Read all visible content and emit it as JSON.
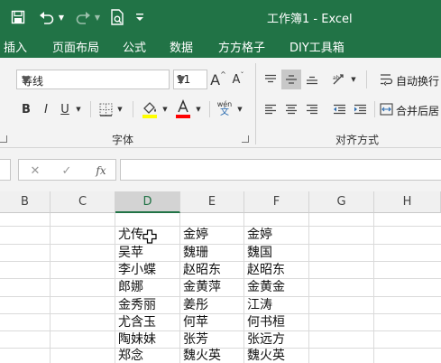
{
  "titlebar": {
    "title": "工作簿1  -  Excel",
    "icons": [
      "save-icon",
      "undo-icon",
      "redo-icon",
      "print-preview-icon",
      "customize-qat-icon"
    ]
  },
  "menu": {
    "tabs": [
      "插入",
      "页面布局",
      "公式",
      "数据",
      "方方格子",
      "DIY工具箱"
    ]
  },
  "ribbon": {
    "font_name": "等线",
    "font_size": "11",
    "grow_font": "A",
    "shrink_font": "A",
    "bold": "B",
    "italic": "I",
    "underline": "U",
    "pinyin_top": "wén",
    "pinyin_bottom": "文",
    "font_group_label": "字体",
    "align_group_label": "对齐方式",
    "wrap_text": "自动换行",
    "merge_center": "合并后居",
    "fill_color": "#ffff00",
    "font_color": "#ff0000"
  },
  "formula_bar": {
    "cancel": "✕",
    "confirm": "✓",
    "fx": "fx",
    "value": ""
  },
  "grid": {
    "columns": [
      "B",
      "C",
      "D",
      "E",
      "F",
      "G",
      "H"
    ],
    "active_column": "D",
    "rows": [
      [
        "尤传",
        "金婷",
        "金婷"
      ],
      [
        "吴苹",
        "魏珊",
        "魏国"
      ],
      [
        "李小蝶",
        "赵昭东",
        "赵昭东"
      ],
      [
        "郎娜",
        "金黄萍",
        "金黄金"
      ],
      [
        "金秀丽",
        "姜彤",
        "江涛"
      ],
      [
        "尤含玉",
        "何苹",
        "何书桓"
      ],
      [
        "陶妹妹",
        "张芳",
        "张远方"
      ],
      [
        "郑念",
        "魏火英",
        "魏火英"
      ]
    ]
  },
  "colors": {
    "brand": "#217346",
    "ribbon_bg": "#f3f3f3"
  }
}
